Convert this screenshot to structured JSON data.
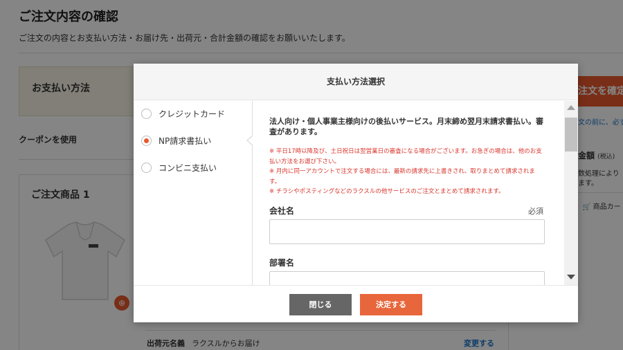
{
  "page": {
    "title": "ご注文内容の確認",
    "subtitle": "ご注文の内容とお支払い方法・お届け先・出荷元・合計金額の確認をお願いいたします。",
    "payment_section_title": "お支払い方法",
    "coupon_label": "クーポンを使用",
    "order_title": "ご注文商品 1",
    "shipper_label": "出荷元名義",
    "shipper_value": "ラクスルからお届け",
    "shipper_change": "変更する",
    "confirm_button": "注文を確定",
    "notice": "文の前に、必ず",
    "total_label": "金額",
    "total_tax": "(税込)",
    "total_note1": "数処理により",
    "total_note2": "ます。",
    "cart_link": "商品カート"
  },
  "modal": {
    "title": "支払い方法選択",
    "options": [
      {
        "label": "クレジットカード",
        "selected": false
      },
      {
        "label": "NP請求書払い",
        "selected": true
      },
      {
        "label": "コンビニ支払い",
        "selected": false
      }
    ],
    "description": "法人向け・個人事業主様向けの後払いサービス。月末締め翌月末請求書払い。審査があります。",
    "warnings": [
      "※ 平日17時以降及び、土日祝日は翌営業日の審査になる場合がございます。お急ぎの場合は、他のお支払い方法をお選び下さい。",
      "※ 月内に同一アカウントで注文する場合には、最新の請求先に上書きされ、取りまとめて請求されます。",
      "※ チラシやポスティングなどのラクスルの他サービスのご注文とまとめて請求されます。"
    ],
    "fields": [
      {
        "label": "会社名",
        "required": "必須",
        "value": "",
        "placeholder": ""
      },
      {
        "label": "部署名",
        "value": "",
        "placeholder": ""
      }
    ],
    "close_button": "閉じる",
    "ok_button": "決定する"
  },
  "colors": {
    "accent": "#e8592d",
    "link": "#1a73c9",
    "warning": "#d9342b"
  }
}
